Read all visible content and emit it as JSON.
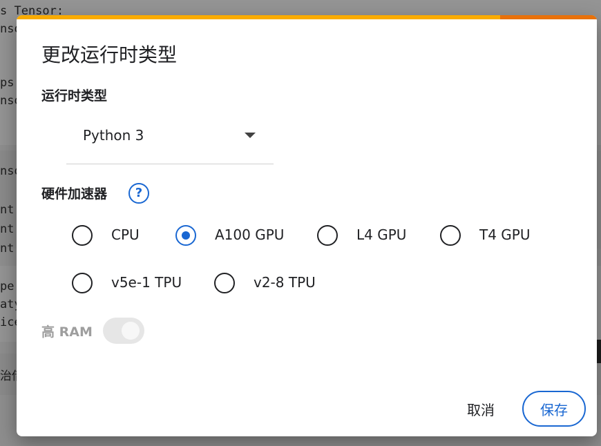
{
  "background": {
    "code_lines": [
      "s Tensor:",
      "nso",
      "ps",
      "nso",
      "nsor",
      "nt",
      "nt",
      "nt",
      "pe",
      "aty",
      "ice",
      "治借"
    ]
  },
  "dialog": {
    "title": "更改运行时类型",
    "runtime_label": "运行时类型",
    "runtime_value": "Python 3",
    "accelerator_label": "硬件加速器",
    "help_glyph": "?",
    "accelerators": [
      {
        "label": "CPU",
        "checked": false
      },
      {
        "label": "A100 GPU",
        "checked": true
      },
      {
        "label": "L4 GPU",
        "checked": false
      },
      {
        "label": "T4 GPU",
        "checked": false
      },
      {
        "label": "v5e-1 TPU",
        "checked": false
      },
      {
        "label": "v2-8 TPU",
        "checked": false
      }
    ],
    "high_ram_label": "高 RAM",
    "high_ram_enabled": false,
    "cancel_label": "取消",
    "save_label": "保存"
  },
  "colors": {
    "accent": "#1967d2",
    "progress_primary": "#f9ab00",
    "progress_secondary": "#e8710a"
  },
  "icons": {
    "help": "help-circle-icon",
    "dropdown": "caret-down-icon"
  }
}
